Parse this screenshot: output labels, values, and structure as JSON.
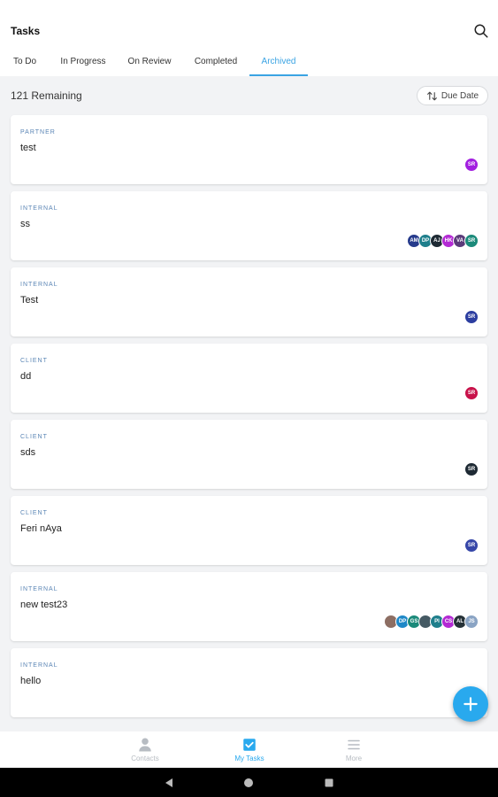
{
  "header": {
    "title": "Tasks"
  },
  "tabs": [
    {
      "label": "To Do"
    },
    {
      "label": "In Progress"
    },
    {
      "label": "On Review"
    },
    {
      "label": "Completed"
    },
    {
      "label": "Archived",
      "active": true
    }
  ],
  "summary": {
    "remaining": "121 Remaining",
    "sort_label": "Due Date"
  },
  "tasks": [
    {
      "category": "PARTNER",
      "name": "test",
      "assignees": [
        {
          "initials": "SR",
          "color": "#a21fe0"
        }
      ]
    },
    {
      "category": "INTERNAL",
      "name": "ss",
      "assignees": [
        {
          "initials": "AM",
          "color": "#263b8c"
        },
        {
          "initials": "DP",
          "color": "#1f7f8c"
        },
        {
          "initials": "AJ",
          "color": "#1e2a34"
        },
        {
          "initials": "HK",
          "color": "#b32ad4"
        },
        {
          "initials": "VA",
          "color": "#5b3b7a"
        },
        {
          "initials": "SR",
          "color": "#1b8a7a"
        }
      ]
    },
    {
      "category": "INTERNAL",
      "name": "Test",
      "assignees": [
        {
          "initials": "SR",
          "color": "#2c3ea0"
        }
      ]
    },
    {
      "category": "CLIENT",
      "name": "dd",
      "assignees": [
        {
          "initials": "SR",
          "color": "#c8124a"
        }
      ]
    },
    {
      "category": "CLIENT",
      "name": "sds",
      "assignees": [
        {
          "initials": "SR",
          "color": "#1e2a34"
        }
      ]
    },
    {
      "category": "CLIENT",
      "name": "Feri nAya",
      "assignees": [
        {
          "initials": "SR",
          "color": "#3646a8"
        }
      ]
    },
    {
      "category": "INTERNAL",
      "name": "new test23",
      "assignees": [
        {
          "initials": "",
          "color": "#8d6e63"
        },
        {
          "initials": "DP",
          "color": "#1e88c7"
        },
        {
          "initials": "GS",
          "color": "#1b8a7a"
        },
        {
          "initials": "",
          "color": "#455a64"
        },
        {
          "initials": "PI",
          "color": "#1f7f8c"
        },
        {
          "initials": "CS",
          "color": "#b32ad4"
        },
        {
          "initials": "AL",
          "color": "#263238"
        },
        {
          "initials": "JS",
          "color": "#8aa4c4"
        }
      ]
    },
    {
      "category": "INTERNAL",
      "name": "hello",
      "assignees": []
    }
  ],
  "bottom_nav": [
    {
      "label": "Contacts",
      "icon": "person-icon"
    },
    {
      "label": "My Tasks",
      "icon": "checkbox-icon",
      "active": true
    },
    {
      "label": "More",
      "icon": "menu-icon"
    }
  ],
  "colors": {
    "accent": "#29a9ee",
    "category_text": "#5a85b5"
  }
}
